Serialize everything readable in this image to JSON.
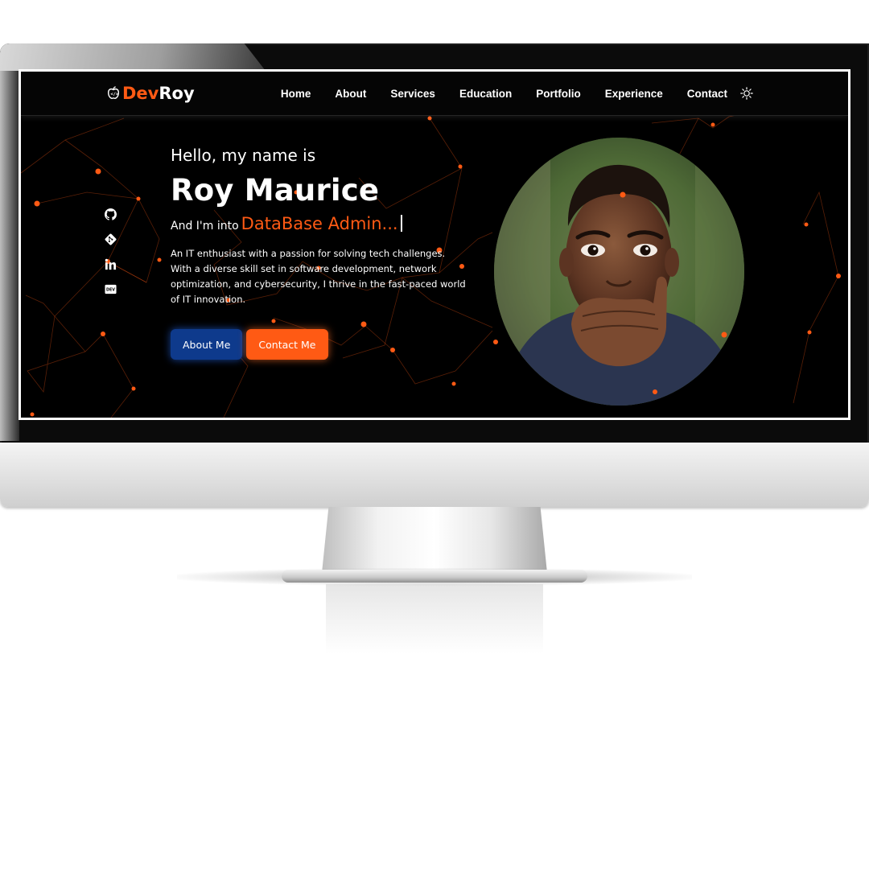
{
  "site": {
    "logo": {
      "icon": "apple-code-icon",
      "part1": "Dev",
      "part2": "Roy"
    },
    "nav": {
      "items": [
        "Home",
        "About",
        "Services",
        "Education",
        "Portfolio",
        "Experience",
        "Contact"
      ],
      "theme_toggle_icon": "sun-icon"
    },
    "social": [
      {
        "icon": "github-icon"
      },
      {
        "icon": "git-icon"
      },
      {
        "icon": "linkedin-icon"
      },
      {
        "icon": "dev-to-icon"
      }
    ],
    "hero": {
      "greeting": "Hello, my name is",
      "name": "Roy Maurice",
      "role_prefix": "And I'm into",
      "role_typed": "DataBase Admin...",
      "bio": "An IT enthusiast with a passion for solving tech challenges. With a diverse skill set in software development, network optimization, and cybersecurity, I thrive in the fast-paced world of IT innovation.",
      "buttons": {
        "about": "About Me",
        "contact": "Contact Me"
      }
    },
    "portrait": {
      "icon": "profile-photo"
    }
  },
  "colors": {
    "accent": "#ff5a14",
    "primary_button": "#0e3a8c",
    "background": "#000000",
    "text": "#ffffff"
  }
}
